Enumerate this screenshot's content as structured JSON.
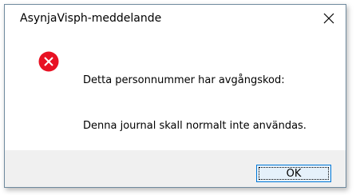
{
  "window": {
    "title": "AsynjaVisph-meddelande",
    "close_icon": "close-icon"
  },
  "message": {
    "icon": "error-icon",
    "icon_color": "#e81123",
    "line1": "Detta personnummer har avgångskod:",
    "line2": "Denna journal skall normalt inte användas."
  },
  "buttons": {
    "ok_label": "OK"
  },
  "colors": {
    "accent": "#0078d7",
    "footer_bg": "#f0f0f0"
  }
}
